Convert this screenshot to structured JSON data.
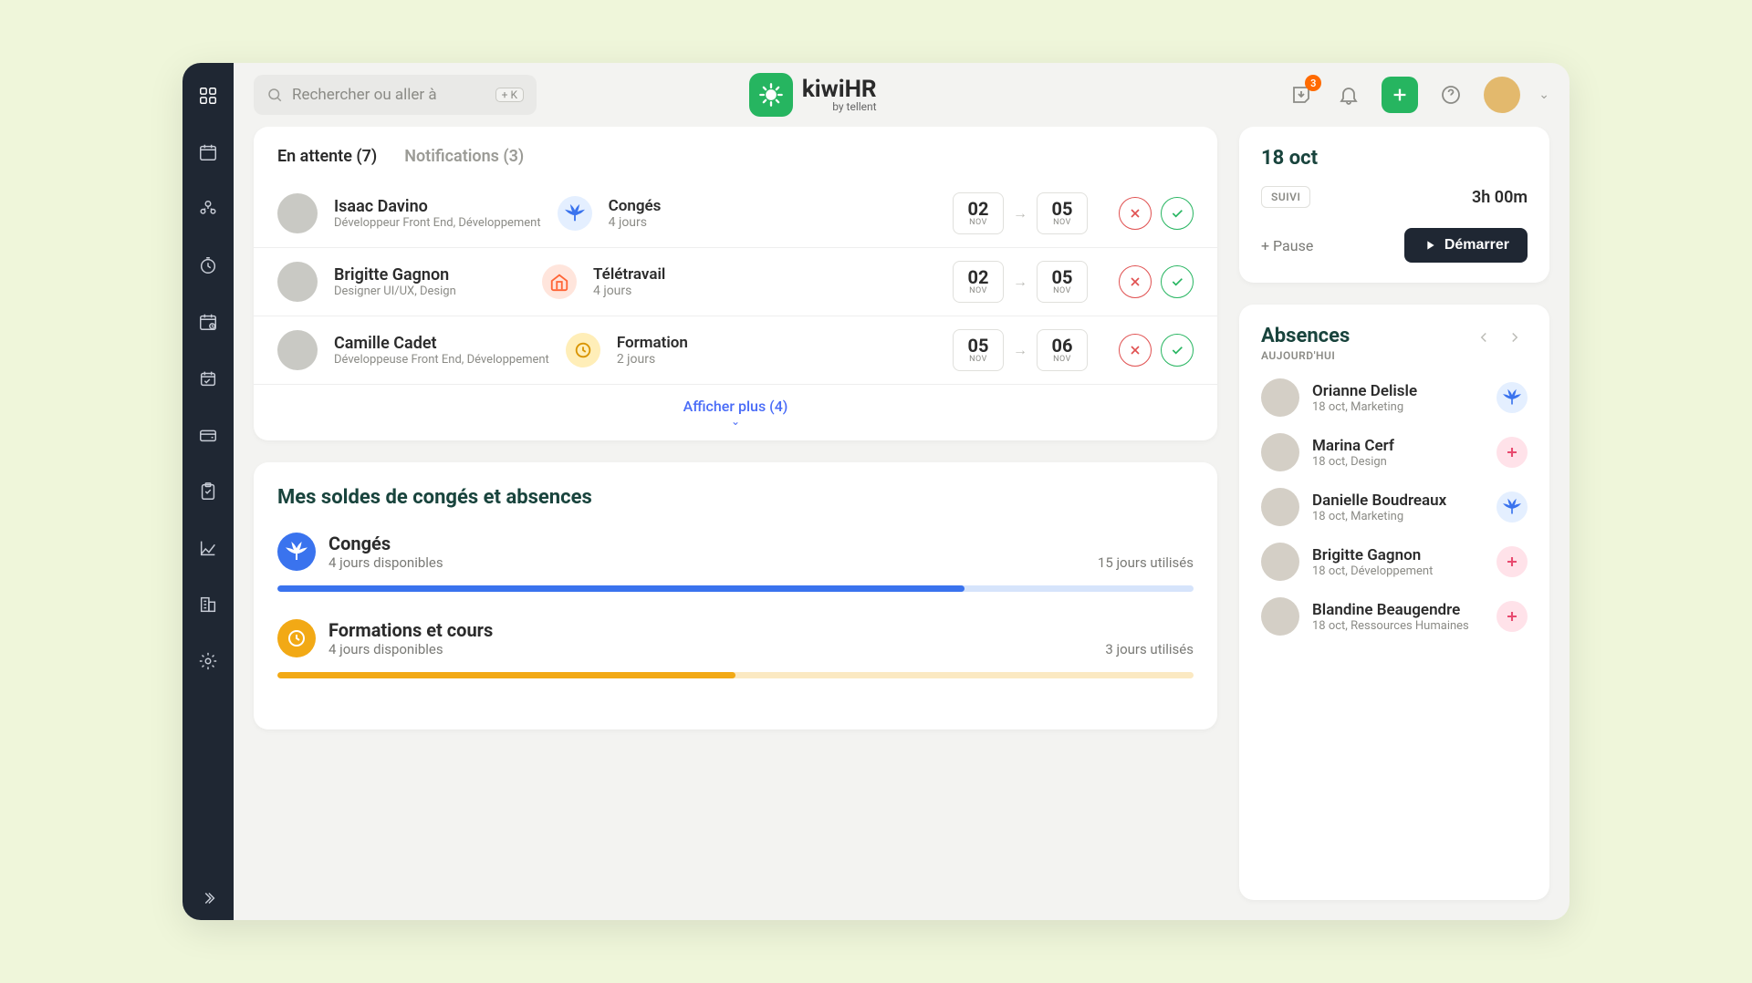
{
  "search": {
    "placeholder": "Rechercher ou aller à",
    "kbd": "+ K"
  },
  "brand": {
    "name": "kiwiHR",
    "by": "by tellent"
  },
  "topbar": {
    "inbox_badge": "3"
  },
  "tabs": {
    "pending": "En attente (7)",
    "notifications": "Notifications (3)"
  },
  "requests": [
    {
      "name": "Isaac Davino",
      "role": "Développeur Front End, Développement",
      "type": "Congés",
      "type_kind": "conges",
      "duration": "4 jours",
      "from_day": "02",
      "from_mon": "NOV",
      "to_day": "05",
      "to_mon": "NOV"
    },
    {
      "name": "Brigitte Gagnon",
      "role": "Designer UI/UX, Design",
      "type": "Télétravail",
      "type_kind": "tele",
      "duration": "4 jours",
      "from_day": "02",
      "from_mon": "NOV",
      "to_day": "05",
      "to_mon": "NOV"
    },
    {
      "name": "Camille Cadet",
      "role": "Développeuse Front End, Développement",
      "type": "Formation",
      "type_kind": "form",
      "duration": "2 jours",
      "from_day": "05",
      "from_mon": "NOV",
      "to_day": "06",
      "to_mon": "NOV"
    }
  ],
  "show_more": "Afficher plus (4)",
  "balances": {
    "title": "Mes soldes de congés et absences",
    "items": [
      {
        "label": "Congés",
        "available": "4 jours disponibles",
        "used": "15 jours utilisés",
        "kind": "blue",
        "pct": 75
      },
      {
        "label": "Formations et cours",
        "available": "4 jours disponibles",
        "used": "3 jours utilisés",
        "kind": "orange",
        "pct": 50
      }
    ]
  },
  "time": {
    "date": "18 oct",
    "suivi": "SUIVI",
    "elapsed": "3h 00m",
    "pause": "+ Pause",
    "start": "Démarrer"
  },
  "absences": {
    "title": "Absences",
    "subtitle": "AUJOURD'HUI",
    "list": [
      {
        "name": "Orianne Delisle",
        "sub": "18 oct, Marketing",
        "icon": "palm"
      },
      {
        "name": "Marina Cerf",
        "sub": "18 oct, Design",
        "icon": "med"
      },
      {
        "name": "Danielle Boudreaux",
        "sub": "18 oct, Marketing",
        "icon": "palm"
      },
      {
        "name": "Brigitte Gagnon",
        "sub": "18 oct, Développement",
        "icon": "med"
      },
      {
        "name": "Blandine Beaugendre",
        "sub": "18 oct, Ressources Humaines",
        "icon": "med"
      }
    ]
  }
}
